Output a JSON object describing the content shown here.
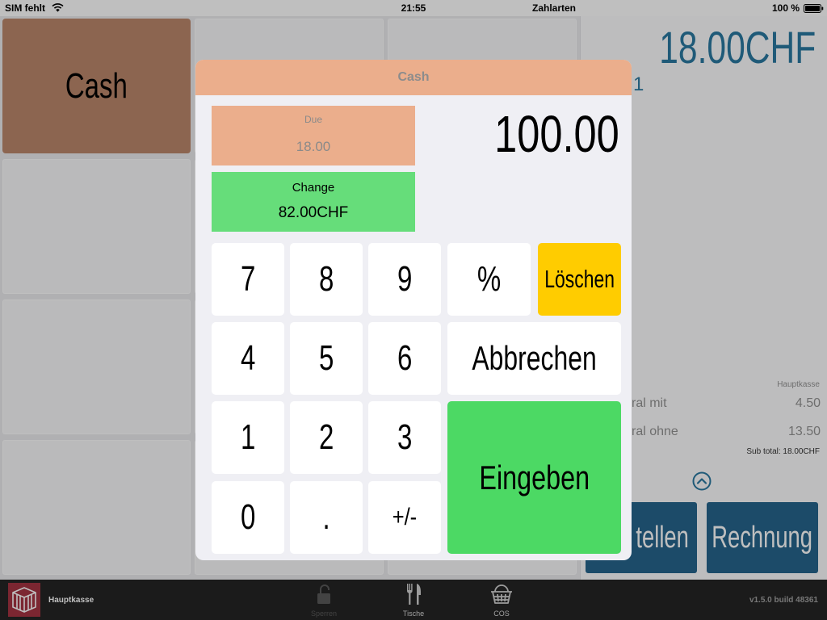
{
  "status_bar": {
    "carrier": "SIM fehlt",
    "time": "21:55",
    "screen_title": "Zahlarten",
    "battery": "100 %",
    "icons": [
      "wifi-icon",
      "battery-icon"
    ]
  },
  "payment_tiles": [
    {
      "label": "Cash"
    }
  ],
  "order_panel": {
    "total": "18.00CHF",
    "line_fragment": "1",
    "register": "Hauptkasse",
    "tax_lines": [
      {
        "label": "ral mit",
        "amount": "4.50"
      },
      {
        "label": "ral ohne",
        "amount": "13.50"
      }
    ],
    "subtotal": "Sub total: 18.00CHF",
    "expand_icon": "chevron-up-circle-icon",
    "order_button": "tellen",
    "bill_button": "Rechnung"
  },
  "toolbar": {
    "logo_icon": "crate-logo-icon",
    "register_name": "Hauptkasse",
    "items": [
      {
        "label": "Sperren",
        "icon": "lock-icon"
      },
      {
        "label": "Tische",
        "icon": "fork-knife-icon"
      },
      {
        "label": "COS",
        "icon": "basket-icon"
      }
    ],
    "version": "v1.5.0 build 48361"
  },
  "dialog": {
    "title": "Cash",
    "due": {
      "label": "Due",
      "value": "18.00"
    },
    "change": {
      "label": "Change",
      "value": "82.00CHF"
    },
    "entered_amount": "100.00",
    "keypad": {
      "keys": [
        "7",
        "8",
        "9",
        "4",
        "5",
        "6",
        "1",
        "2",
        "3",
        "0",
        ".",
        "+/-"
      ],
      "percent": "%",
      "clear": "Löschen",
      "cancel": "Abbrechen",
      "enter": "Eingeben"
    }
  },
  "theme": {
    "dialog_header": "#EBAE8C",
    "due_background": "#EBAE8C",
    "change_background": "#66DD7A",
    "clear_key": "#FFCC00",
    "enter_key": "#4CD964",
    "accent_blue": "#2A78A1",
    "cash_tile": "#BB876B"
  }
}
